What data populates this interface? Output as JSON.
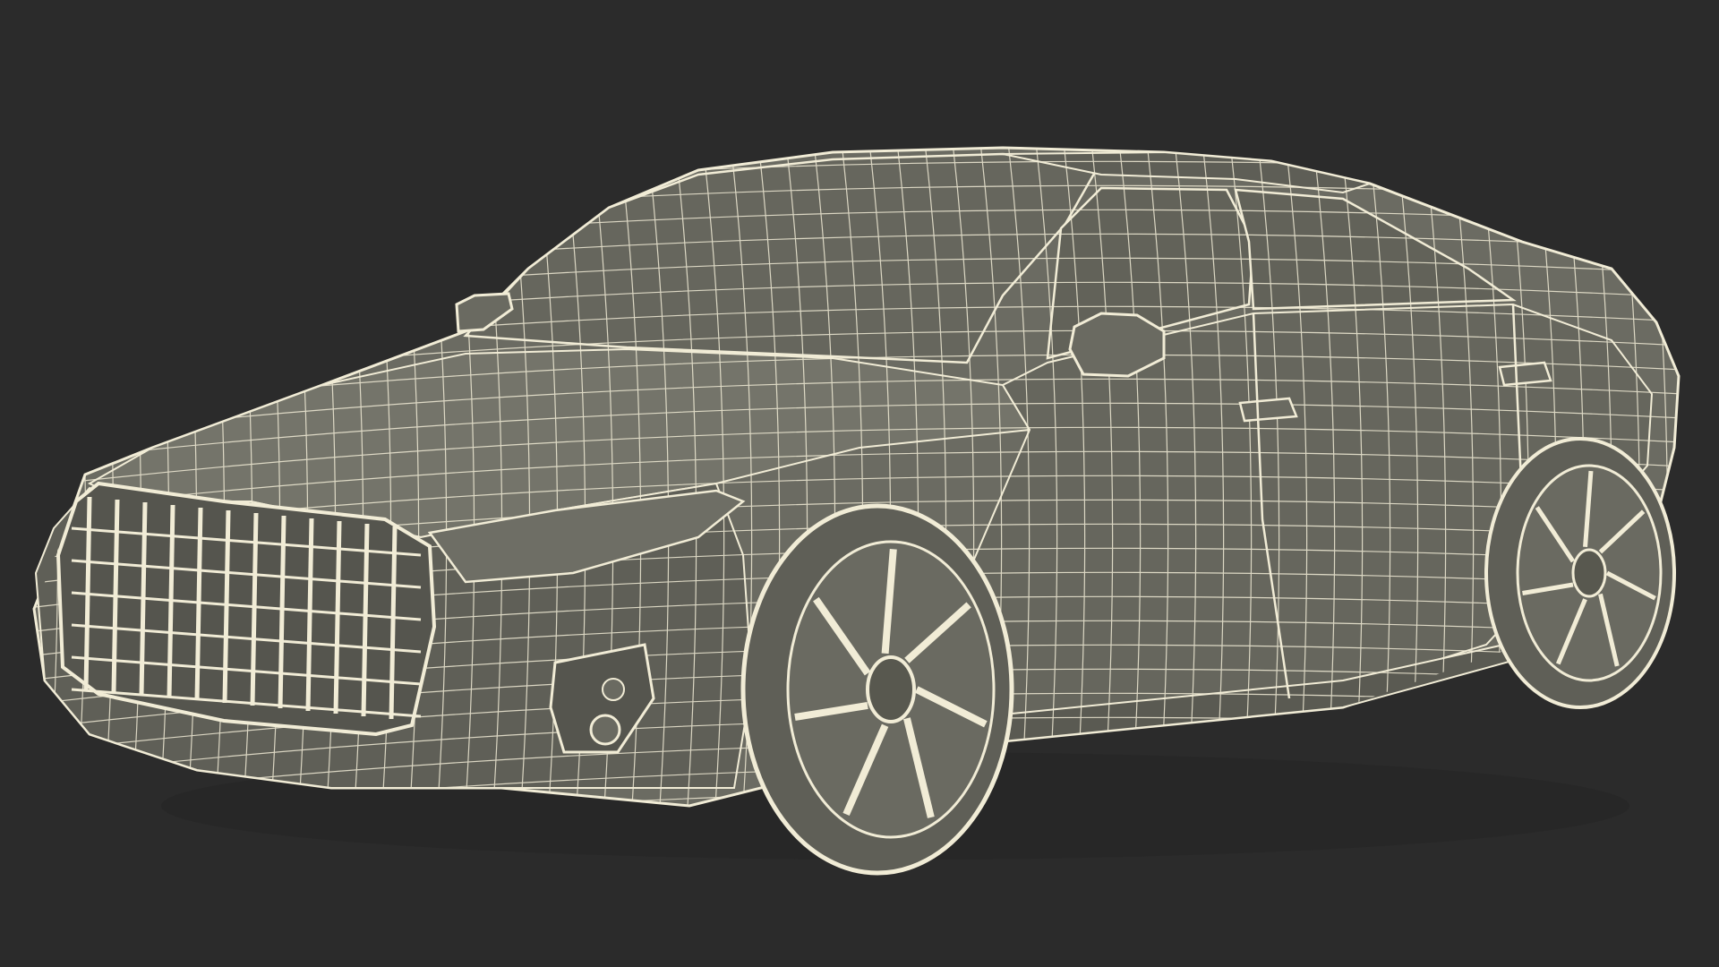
{
  "scene": {
    "subject": "sedan-wireframe",
    "colors": {
      "background": "#2b2b2b",
      "surface": "#6b6b62",
      "surface_dark": "#55554e",
      "surface_light": "#7a7a70",
      "wire": "#f1ecd6",
      "glass": "#626259",
      "tire": "#5f5f57"
    }
  }
}
